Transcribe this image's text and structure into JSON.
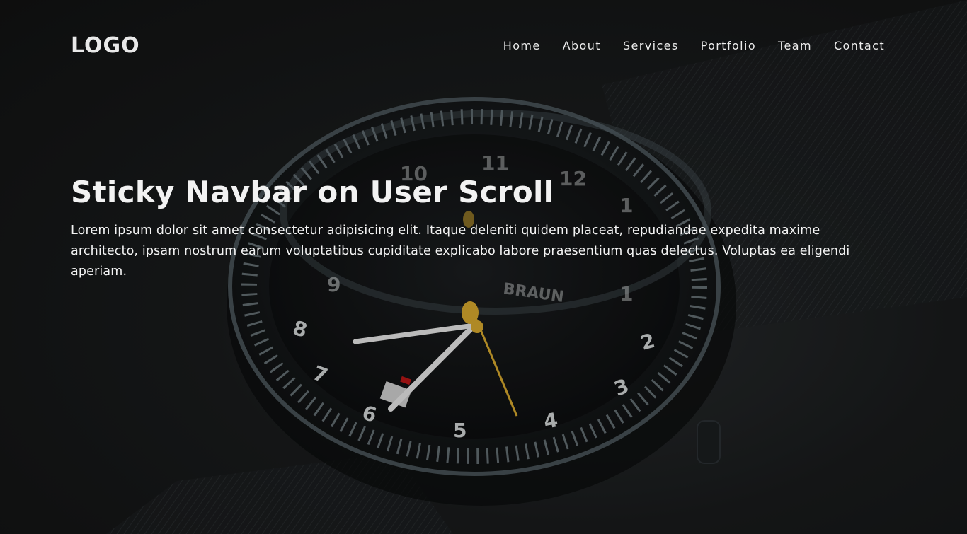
{
  "navbar": {
    "logo": "LOGO",
    "links": [
      {
        "label": "Home"
      },
      {
        "label": "About"
      },
      {
        "label": "Services"
      },
      {
        "label": "Portfolio"
      },
      {
        "label": "Team"
      },
      {
        "label": "Contact"
      }
    ]
  },
  "hero": {
    "title": "Sticky Navbar on User Scroll",
    "description": "Lorem ipsum dolor sit amet consectetur adipisicing elit. Itaque deleniti quidem placeat, repudiandae expedita maxime architecto, ipsam nostrum earum voluptatibus cupiditate explicabo labore praesentium quas delectus. Voluptas ea eligendi aperiam.",
    "background_image": "wristwatch-photo",
    "watch_brand": "BRAUN",
    "watch_numbers": [
      "1",
      "2",
      "3",
      "4",
      "5",
      "6",
      "7",
      "8",
      "9",
      "10",
      "11",
      "12"
    ]
  },
  "colors": {
    "text": "#ffffff",
    "background": "#141616",
    "accent_hand": "#e0b030"
  }
}
